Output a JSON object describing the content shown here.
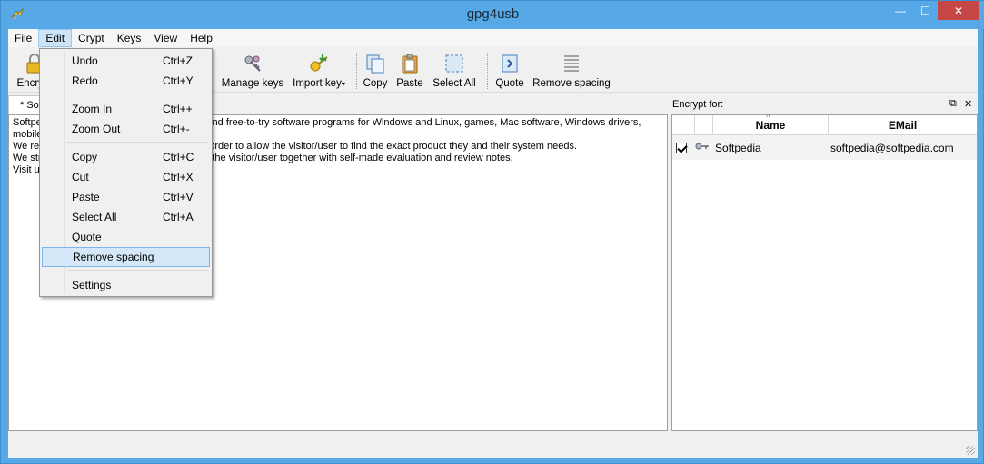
{
  "window": {
    "title": "gpg4usb",
    "minimize": "—",
    "maximize": "☐",
    "close": "✕"
  },
  "menubar": {
    "items": [
      "File",
      "Edit",
      "Crypt",
      "Keys",
      "View",
      "Help"
    ]
  },
  "toolbar": {
    "encrypt": "Encrypt",
    "manage_keys": "Manage keys",
    "import_key": "Import key",
    "copy": "Copy",
    "paste": "Paste",
    "select_all": "Select All",
    "quote": "Quote",
    "remove_spacing": "Remove spacing"
  },
  "editor": {
    "tab_label": "* Softpedia",
    "lines": [
      "Softpedia is a library of over 1,300,000 free and free-to-try software programs for Windows and Linux, games, Mac software, Windows drivers,",
      "mobile devices and IT-related articles.",
      "We review and categorize these products in order to allow the visitor/user to find the exact product they and their system needs.",
      "We strive to deliver only the best products to the visitor/user together with self-made evaluation and review notes.",
      "Visit us at http://www.softpedia.com"
    ]
  },
  "encrypt_panel": {
    "title": "Encrypt for:",
    "columns": [
      "",
      "",
      "Name",
      "EMail"
    ],
    "rows": [
      {
        "checked": true,
        "name": "Softpedia",
        "email": "softpedia@softpedia.com"
      }
    ]
  },
  "edit_menu": {
    "items": [
      {
        "label": "Undo",
        "shortcut": "Ctrl+Z"
      },
      {
        "label": "Redo",
        "shortcut": "Ctrl+Y"
      },
      {
        "label": "Zoom In",
        "shortcut": "Ctrl++"
      },
      {
        "label": "Zoom Out",
        "shortcut": "Ctrl+-"
      },
      {
        "label": "Copy",
        "shortcut": "Ctrl+C"
      },
      {
        "label": "Cut",
        "shortcut": "Ctrl+X"
      },
      {
        "label": "Paste",
        "shortcut": "Ctrl+V"
      },
      {
        "label": "Select All",
        "shortcut": "Ctrl+A"
      },
      {
        "label": "Quote",
        "shortcut": ""
      },
      {
        "label": "Remove spacing",
        "shortcut": ""
      },
      {
        "label": "Settings",
        "shortcut": ""
      }
    ],
    "highlighted": "Remove spacing"
  },
  "colors": {
    "titlebar": "#56a8e6",
    "close": "#c74646",
    "highlight": "#d5e8f9"
  }
}
